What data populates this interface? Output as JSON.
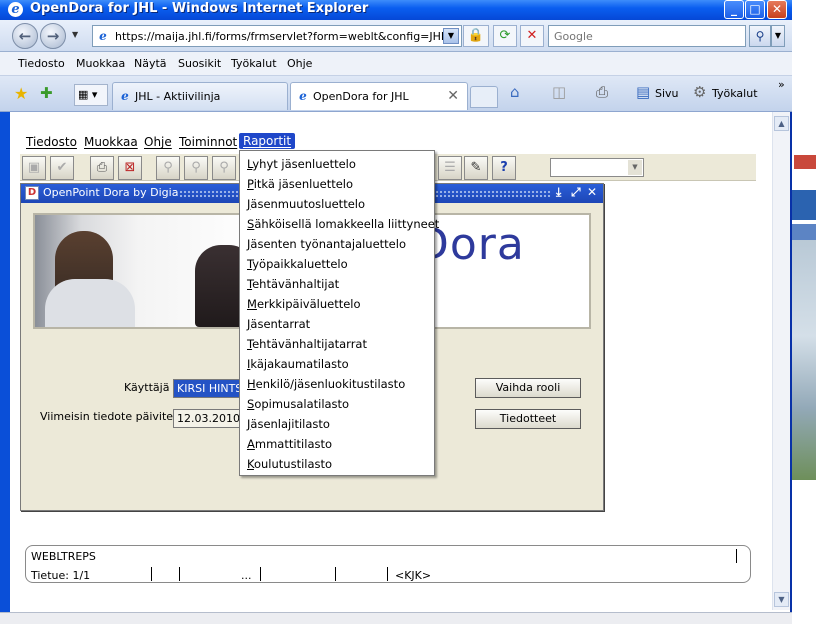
{
  "window": {
    "title": "OpenDora for JHL - Windows Internet Explorer",
    "minimize": "_",
    "maximize": "□",
    "close": "✕"
  },
  "address": {
    "url": "https://maija.jhl.fi/forms/frmservlet?form=weblt&config=JHL",
    "search_placeholder": "Google"
  },
  "ie_menu": [
    "Tiedosto",
    "Muokkaa",
    "Näytä",
    "Suosikit",
    "Työkalut",
    "Ohje"
  ],
  "tabs": [
    {
      "label": "JHL - Aktiivilinja",
      "active": false
    },
    {
      "label": "OpenDora for JHL",
      "active": true
    }
  ],
  "commands": {
    "page": "Sivu",
    "tools": "Työkalut"
  },
  "app_menu": {
    "items": [
      "Tiedosto",
      "Muokkaa",
      "Ohje",
      "Toiminnot",
      "Raportit"
    ],
    "selected": "Raportit"
  },
  "inner_window": {
    "title": "OpenPoint Dora by Digia",
    "logo_text": "Dora"
  },
  "form": {
    "user_label": "Käyttäjä",
    "user_value": "KIRSI HINTSA",
    "bulletin_label": "Viimeisin tiedote päivitetty",
    "bulletin_date": "12.03.2010",
    "change_role_button": "Vaihda rooli",
    "bulletins_button": "Tiedotteet"
  },
  "reports_menu": [
    "Lyhyt jäsenluettelo",
    "Pitkä jäsenluettelo",
    "Jäsenmuutosluettelo",
    "Sähköisellä lomakkeella liittyneet",
    "Jäsenten työnantajaluettelo",
    "Työpaikkaluettelo",
    "Tehtävänhaltijat",
    "Merkkipäiväluettelo",
    "Jäsentarrat",
    "Tehtävänhaltijatarrat",
    "Ikäjakaumatilasto",
    "Henkilö/jäsenluokitustilasto",
    "Sopimusalatilasto",
    "Jäsenlajitilasto",
    "Ammattitilasto",
    "Koulutustilasto"
  ],
  "status": {
    "module": "WEBLTREPS",
    "record": "Tietue: 1/1",
    "dots": "...",
    "mode": "<KJK>"
  },
  "colors": {
    "title_bar": "#0a5ef0",
    "menu_highlight": "#1f47c9",
    "dialog_bg": "#ece9d8"
  }
}
